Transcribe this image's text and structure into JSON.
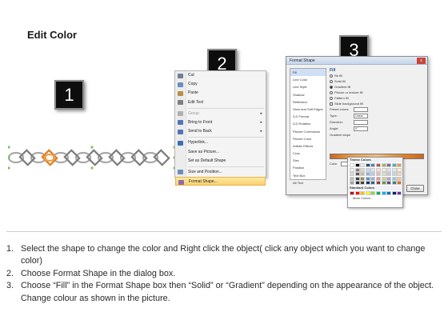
{
  "title": "Edit Color",
  "step_numbers": [
    "1",
    "2",
    "3"
  ],
  "context_menu": {
    "items": [
      {
        "label": "Cut",
        "icon": "scissors-icon",
        "color": "#6f7f99",
        "disabled": false
      },
      {
        "label": "Copy",
        "icon": "copy-icon",
        "color": "#6a8cc2",
        "disabled": false
      },
      {
        "label": "Paste",
        "icon": "paste-icon",
        "color": "#b78e4a",
        "disabled": false
      },
      {
        "label": "Edit Text",
        "icon": "edit-text-icon",
        "color": "#7f7f7f",
        "disabled": false
      },
      {
        "label": "Group",
        "icon": "group-icon",
        "color": "#b0b0b0",
        "disabled": true,
        "submenu": true
      },
      {
        "label": "Bring to Front",
        "icon": "bring-front-icon",
        "color": "#4f77b5",
        "disabled": false,
        "submenu": true
      },
      {
        "label": "Send to Back",
        "icon": "send-back-icon",
        "color": "#4f77b5",
        "disabled": false,
        "submenu": true
      },
      {
        "label": "Hyperlink...",
        "icon": "hyperlink-icon",
        "color": "#3c6db5",
        "disabled": false
      },
      {
        "label": "Save as Picture...",
        "icon": "",
        "color": "",
        "disabled": false
      },
      {
        "label": "Set as Default Shape",
        "icon": "",
        "color": "",
        "disabled": false
      },
      {
        "label": "Size and Position...",
        "icon": "size-icon",
        "color": "#6d8dbd",
        "disabled": false
      },
      {
        "label": "Format Shape...",
        "icon": "format-shape-icon",
        "color": "#8e6cae",
        "disabled": false,
        "selected": true
      }
    ]
  },
  "dialog": {
    "title": "Format Shape",
    "close": "x",
    "nav": [
      "Fill",
      "Line Color",
      "Line Style",
      "Shadow",
      "Reflection",
      "Glow and Soft Edges",
      "3-D Format",
      "3-D Rotation",
      "Picture Corrections",
      "Picture Color",
      "Artistic Effects",
      "Crop",
      "Size",
      "Position",
      "Text Box",
      "Alt Text"
    ],
    "fill_heading": "Fill",
    "fill_options": [
      "No fill",
      "Solid fill",
      "Gradient fill",
      "Picture or texture fill",
      "Pattern fill",
      "Slide background fill"
    ],
    "fields": {
      "preset": "Preset colors:",
      "type": "Type:",
      "type_value": "Linear",
      "direction": "Direction:",
      "angle": "Angle:",
      "angle_value": "0°",
      "stops": "Gradient stops",
      "color": "Color",
      "position": "Position:",
      "position_value": "0%",
      "brightness": "Brightness:",
      "transparency": "Transparency:",
      "rotate": "Rotate with shape"
    },
    "popup": {
      "theme_label": "Theme Colors",
      "standard_label": "Standard Colors",
      "more": "More Colors...",
      "theme_colors": [
        "#ffffff",
        "#000000",
        "#eeece1",
        "#1f497d",
        "#4f81bd",
        "#c0504d",
        "#9bbb59",
        "#8064a2",
        "#4bacc6",
        "#f79646",
        "#f2f2f2",
        "#7f7f7f",
        "#ddd9c3",
        "#c6d9f0",
        "#dbe5f1",
        "#f2dcdb",
        "#ebf1dd",
        "#e5e0ec",
        "#dbeef3",
        "#fdeada",
        "#d8d8d8",
        "#595959",
        "#c4bd97",
        "#8db3e2",
        "#b8cce4",
        "#e5b9b7",
        "#d7e3bc",
        "#ccc1d9",
        "#b7dde8",
        "#fbd5b5",
        "#bfbfbf",
        "#3f3f3f",
        "#938953",
        "#548dd4",
        "#95b3d7",
        "#d99694",
        "#c3d69b",
        "#b2a2c7",
        "#92cddc",
        "#fac08f",
        "#a5a5a5",
        "#262626",
        "#494429",
        "#17365d",
        "#366092",
        "#953734",
        "#76923c",
        "#5f497a",
        "#31859b",
        "#e36c09"
      ],
      "standard_colors": [
        "#c00000",
        "#ff0000",
        "#ffc000",
        "#ffff00",
        "#92d050",
        "#00b050",
        "#00b0f0",
        "#0070c0",
        "#002060",
        "#7030a0"
      ]
    },
    "close_button": "Close"
  },
  "instructions": [
    {
      "num": "1.",
      "text": "Select the shape to change the color and Right click the object( click any object which you want to change color)"
    },
    {
      "num": "2.",
      "text": "Choose Format Shape in the dialog box."
    },
    {
      "num": "3.",
      "text": "Choose “Fill” in the Format Shape box then “Solid” or “Gradient” depending on the appearance of the object. Change colour as shown in the picture."
    }
  ]
}
